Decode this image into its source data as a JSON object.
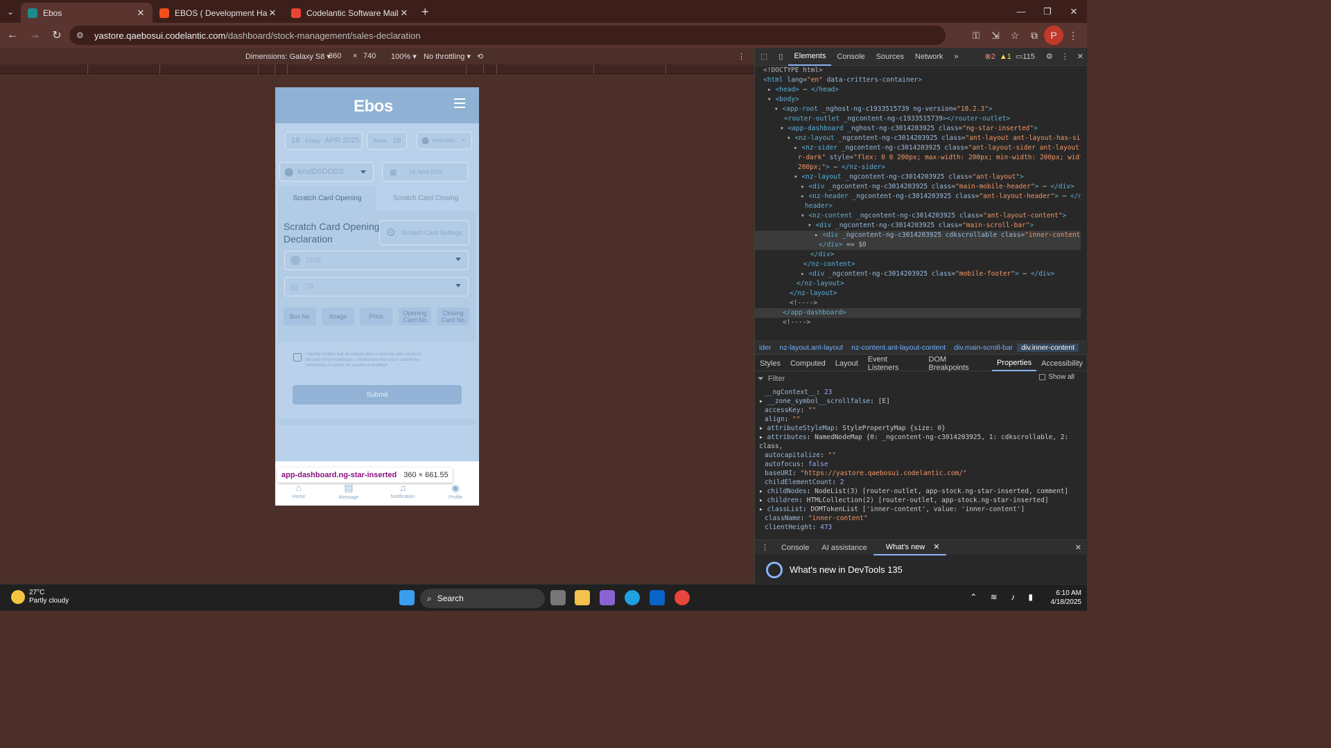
{
  "browser": {
    "tabs": [
      {
        "title": "Ebos",
        "active": true,
        "favicon_color": "#1f8a8a"
      },
      {
        "title": "EBOS ( Development Handoff )",
        "active": false,
        "favicon_color": "#f24e1e"
      },
      {
        "title": "Codelantic Software Mail",
        "active": false,
        "favicon_color": "#ea4335"
      }
    ],
    "url_host": "yastore.qaebosui.codelantic.com",
    "url_path": "/dashboard/stock-management/sales-declaration",
    "profile_initial": "P"
  },
  "device_toolbar": {
    "dimensions_label": "Dimensions: Galaxy S8",
    "width": "360",
    "times": "×",
    "height": "740",
    "zoom": "100%",
    "throttling": "No throttling"
  },
  "app": {
    "logo": "Ebos",
    "date_day_num": "18",
    "date_weekday": "Friday",
    "date_month_year": "APR 2025",
    "week_label": "Week",
    "week_num": "16",
    "location_small": "kindDSDD...",
    "location_select": "kindDSDDDS",
    "date_field": "18-April-2025",
    "tab_opening": "Scratch Card Opening",
    "tab_closing": "Scratch Card Closing",
    "decl_title": "Scratch Card Opening Declaration",
    "settings_btn": "Scratch Card Settings",
    "shift_placeholder": "Shift",
    "till_placeholder": "Till",
    "columns": [
      "Box No",
      "Image",
      "Price",
      "Opening Card No",
      "Closing Card No"
    ],
    "confirm_text": "I hereby confirm that all entered data is accurate and correct to the best of my knowledge. I understand that once I submit this information, it cannot be undone or modified.",
    "submit": "Submit",
    "nav": [
      "Home",
      "Message",
      "Notification",
      "Profile"
    ]
  },
  "tooltip": {
    "selector": "app-dashboard.ng-star-inserted",
    "size": "360 × 661.55"
  },
  "devtools": {
    "tabs": [
      "Elements",
      "Console",
      "Sources",
      "Network"
    ],
    "errors": "2",
    "warnings": "1",
    "messages": "115",
    "breadcrumbs": [
      "ider",
      "nz-layout.ant-layout",
      "nz-content.ant-layout-content",
      "div.main-scroll-bar",
      "div.inner-content"
    ],
    "subtabs": [
      "Styles",
      "Computed",
      "Layout",
      "Event Listeners",
      "DOM Breakpoints",
      "Properties",
      "Accessibility"
    ],
    "filter_placeholder": "Filter",
    "show_all": "Show all",
    "drawer_tabs": [
      "Console",
      "AI assistance",
      "What's new"
    ],
    "whats_new": "What's new in DevTools 135"
  },
  "taskbar": {
    "temperature": "27°C",
    "weather": "Partly cloudy",
    "search": "Search",
    "time": "6:10 AM",
    "date": "4/18/2025"
  }
}
